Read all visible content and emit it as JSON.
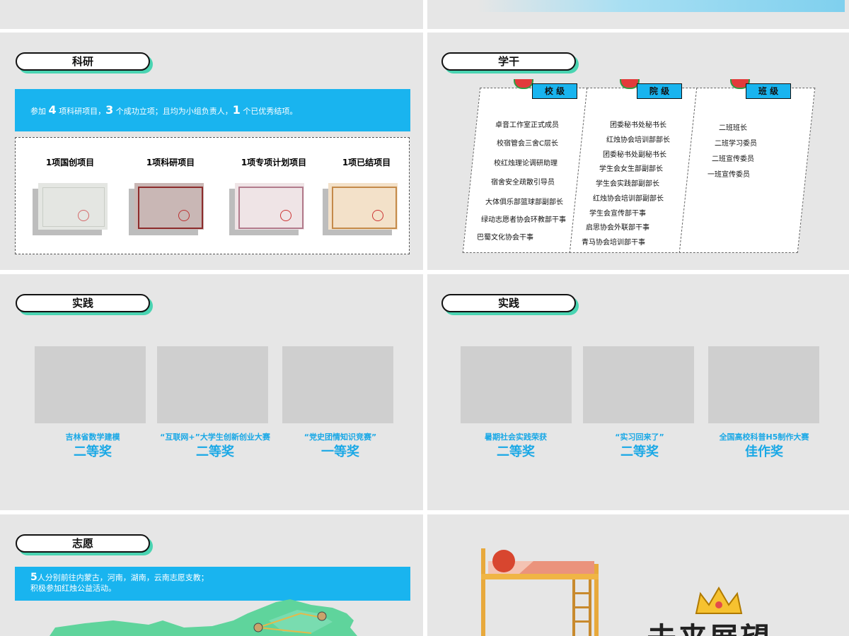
{
  "science": {
    "title": "科研",
    "banner": {
      "t1": "参加",
      "n1": "4",
      "t2": "项科研项目，",
      "n2": "3",
      "t3": "个成功立项；且均为小组负责人，",
      "n3": "1",
      "t4": "个已优秀结项。"
    },
    "certs": [
      "1项国创项目",
      "1项科研项目",
      "1项专项计划项目",
      "1项已结项目"
    ]
  },
  "student_cadre": {
    "title": "学干",
    "groups": [
      {
        "label": "校 级",
        "items": [
          "卓音工作室正式成员",
          "校宿管会三舍C层长",
          "校红烛理论调研助理",
          "宿舍安全疏散引导员",
          "大体俱乐部篮球部副部长",
          "绿动志愿者协会环教部干事",
          "巴蜀文化协会干事"
        ]
      },
      {
        "label": "院 级",
        "items": [
          "团委秘书处秘书长",
          "红烛协会培训部部长",
          "团委秘书处副秘书长",
          "学生会女生部副部长",
          "学生会实践部副部长",
          "红烛协会培训部副部长",
          "学生会宣传部干事",
          "启思协会外联部干事",
          "青马协会培训部干事"
        ]
      },
      {
        "label": "班 级",
        "items": [
          "二班班长",
          "二班学习委员",
          "二班宣传委员",
          "一班宣传委员"
        ]
      }
    ]
  },
  "practice_left": {
    "title": "实践",
    "awards": [
      {
        "name": "吉林省数学建模",
        "rank": "二等奖"
      },
      {
        "name": "“互联网+”大学生创新创业大赛",
        "rank": "二等奖"
      },
      {
        "name": "“党史团情知识竞赛”",
        "rank": "一等奖"
      }
    ]
  },
  "practice_right": {
    "title": "实践",
    "awards": [
      {
        "name": "暑期社会实践荣获",
        "rank": "二等奖"
      },
      {
        "name": "“实习回来了”",
        "rank": "二等奖"
      },
      {
        "name": "全国高校科普H5制作大赛",
        "rank": "佳作奖"
      }
    ]
  },
  "volunteer": {
    "title": "志愿",
    "line1_num": "5",
    "line1": "人分别前往内蒙古，河南，湖南，云南志愿支教；",
    "line2": "积极参加红烛公益活动。"
  },
  "future": {
    "title": "未来展望"
  },
  "colors": {
    "accent": "#19b4ef",
    "mint": "#4ad4b2",
    "panel": "#e6e6e6",
    "placeholder": "#cfcfcf"
  }
}
